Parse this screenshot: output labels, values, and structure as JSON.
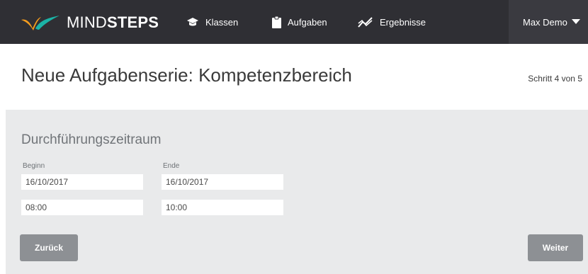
{
  "brand": {
    "name_light": "MIND",
    "name_bold": "STEPS",
    "colors": {
      "orange": "#f39c1e",
      "teal": "#1bb3a6",
      "navbar": "#2f2f34"
    }
  },
  "nav": {
    "items": [
      {
        "label": "Klassen",
        "icon": "graduation-cap-icon"
      },
      {
        "label": "Aufgaben",
        "icon": "clipboard-icon"
      },
      {
        "label": "Ergebnisse",
        "icon": "trend-chart-icon"
      }
    ],
    "user": {
      "label": "Max Demo",
      "icon": "caret-down-icon"
    }
  },
  "page": {
    "title": "Neue Aufgabenserie: Kompetenzbereich",
    "step": "Schritt 4 von 5"
  },
  "section": {
    "title": "Durchführungszeitraum",
    "begin": {
      "label": "Beginn",
      "date": "16/10/2017",
      "time": "08:00"
    },
    "end": {
      "label": "Ende",
      "date": "16/10/2017",
      "time": "10:00"
    }
  },
  "actions": {
    "back": "Zurück",
    "next": "Weiter"
  }
}
